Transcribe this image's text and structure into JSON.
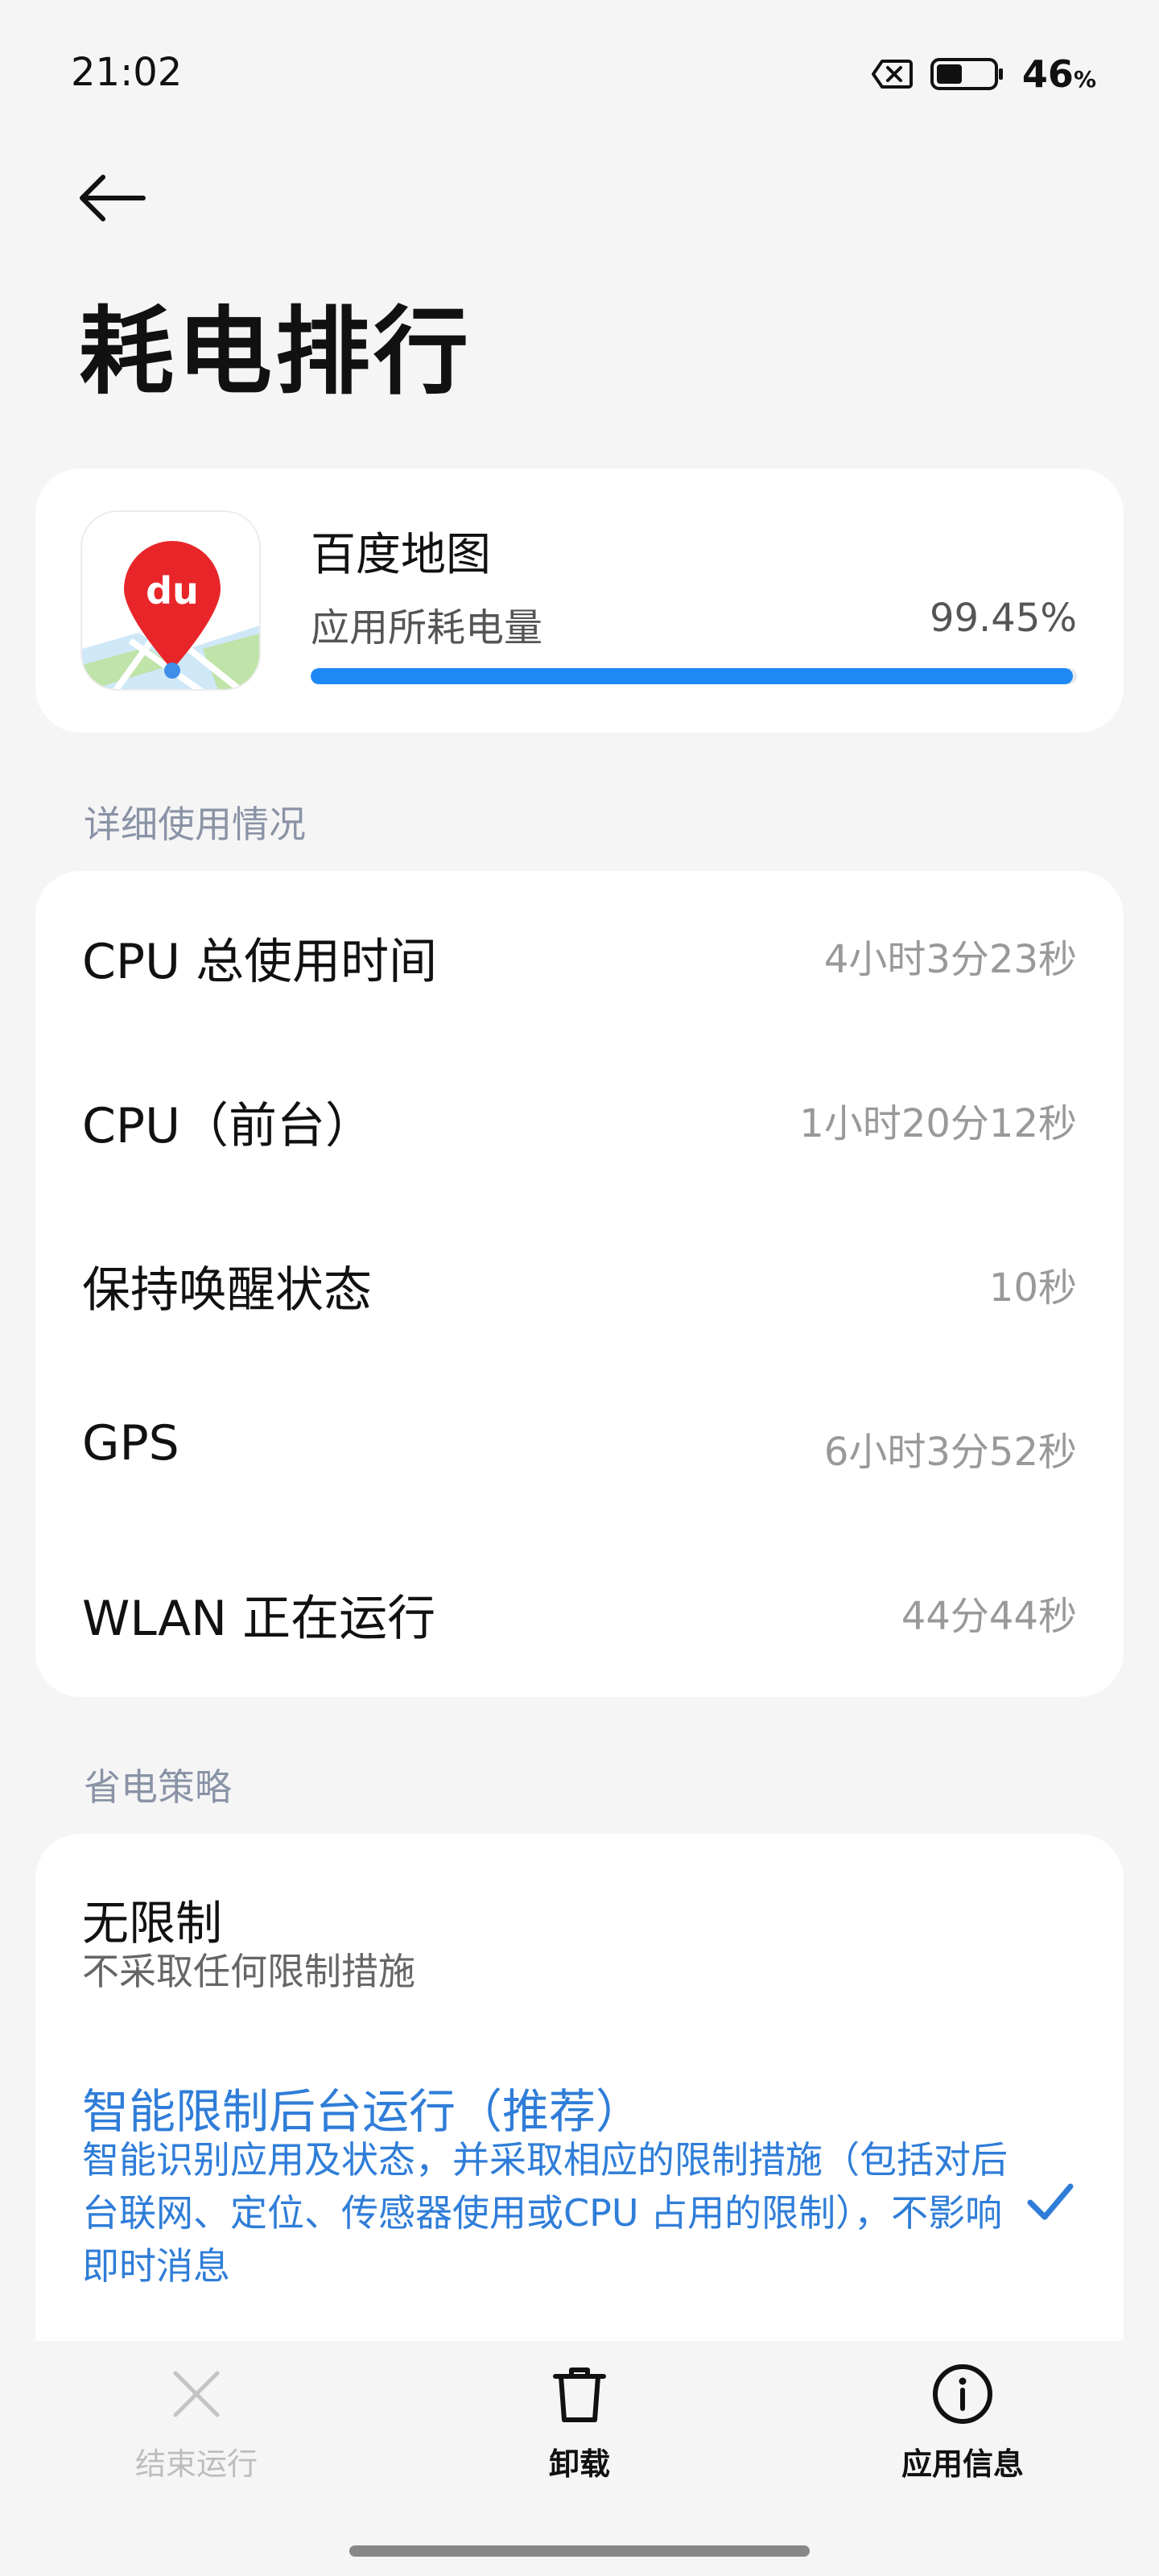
{
  "status_bar": {
    "time": "21:02",
    "battery_percent": "46",
    "battery_unit": "%",
    "battery_level": 0.46,
    "icons": [
      "sim-disabled-icon",
      "battery-icon"
    ]
  },
  "header": {
    "back_icon": "arrow-left-icon",
    "title": "耗电排行"
  },
  "app": {
    "name": "百度地图",
    "icon_text": "du",
    "usage_label": "应用所耗电量",
    "usage_value": "99.45%",
    "usage_fraction": 0.9945,
    "accent_color": "#1e88f5"
  },
  "details": {
    "section_title": "详细使用情况",
    "rows": [
      {
        "label": "CPU 总使用时间",
        "value": "4小时3分23秒"
      },
      {
        "label": "CPU（前台）",
        "value": "1小时20分12秒"
      },
      {
        "label": "保持唤醒状态",
        "value": "10秒"
      },
      {
        "label": "GPS",
        "value": "6小时3分52秒"
      },
      {
        "label": "WLAN 正在运行",
        "value": "44分44秒"
      }
    ]
  },
  "policy": {
    "section_title": "省电策略",
    "options": [
      {
        "title": "无限制",
        "desc": "不采取任何限制措施",
        "selected": false
      },
      {
        "title": "智能限制后台运行（推荐）",
        "desc": "智能识别应用及状态，并采取相应的限制措施（包括对后台联网、定位、传感器使用或CPU 占用的限制），不影响即时消息",
        "selected": true
      }
    ],
    "selected_color": "#2f7dd8"
  },
  "bottom_actions": [
    {
      "label": "结束运行",
      "icon": "close-icon",
      "enabled": false
    },
    {
      "label": "卸载",
      "icon": "trash-icon",
      "enabled": true
    },
    {
      "label": "应用信息",
      "icon": "info-icon",
      "enabled": true
    }
  ]
}
